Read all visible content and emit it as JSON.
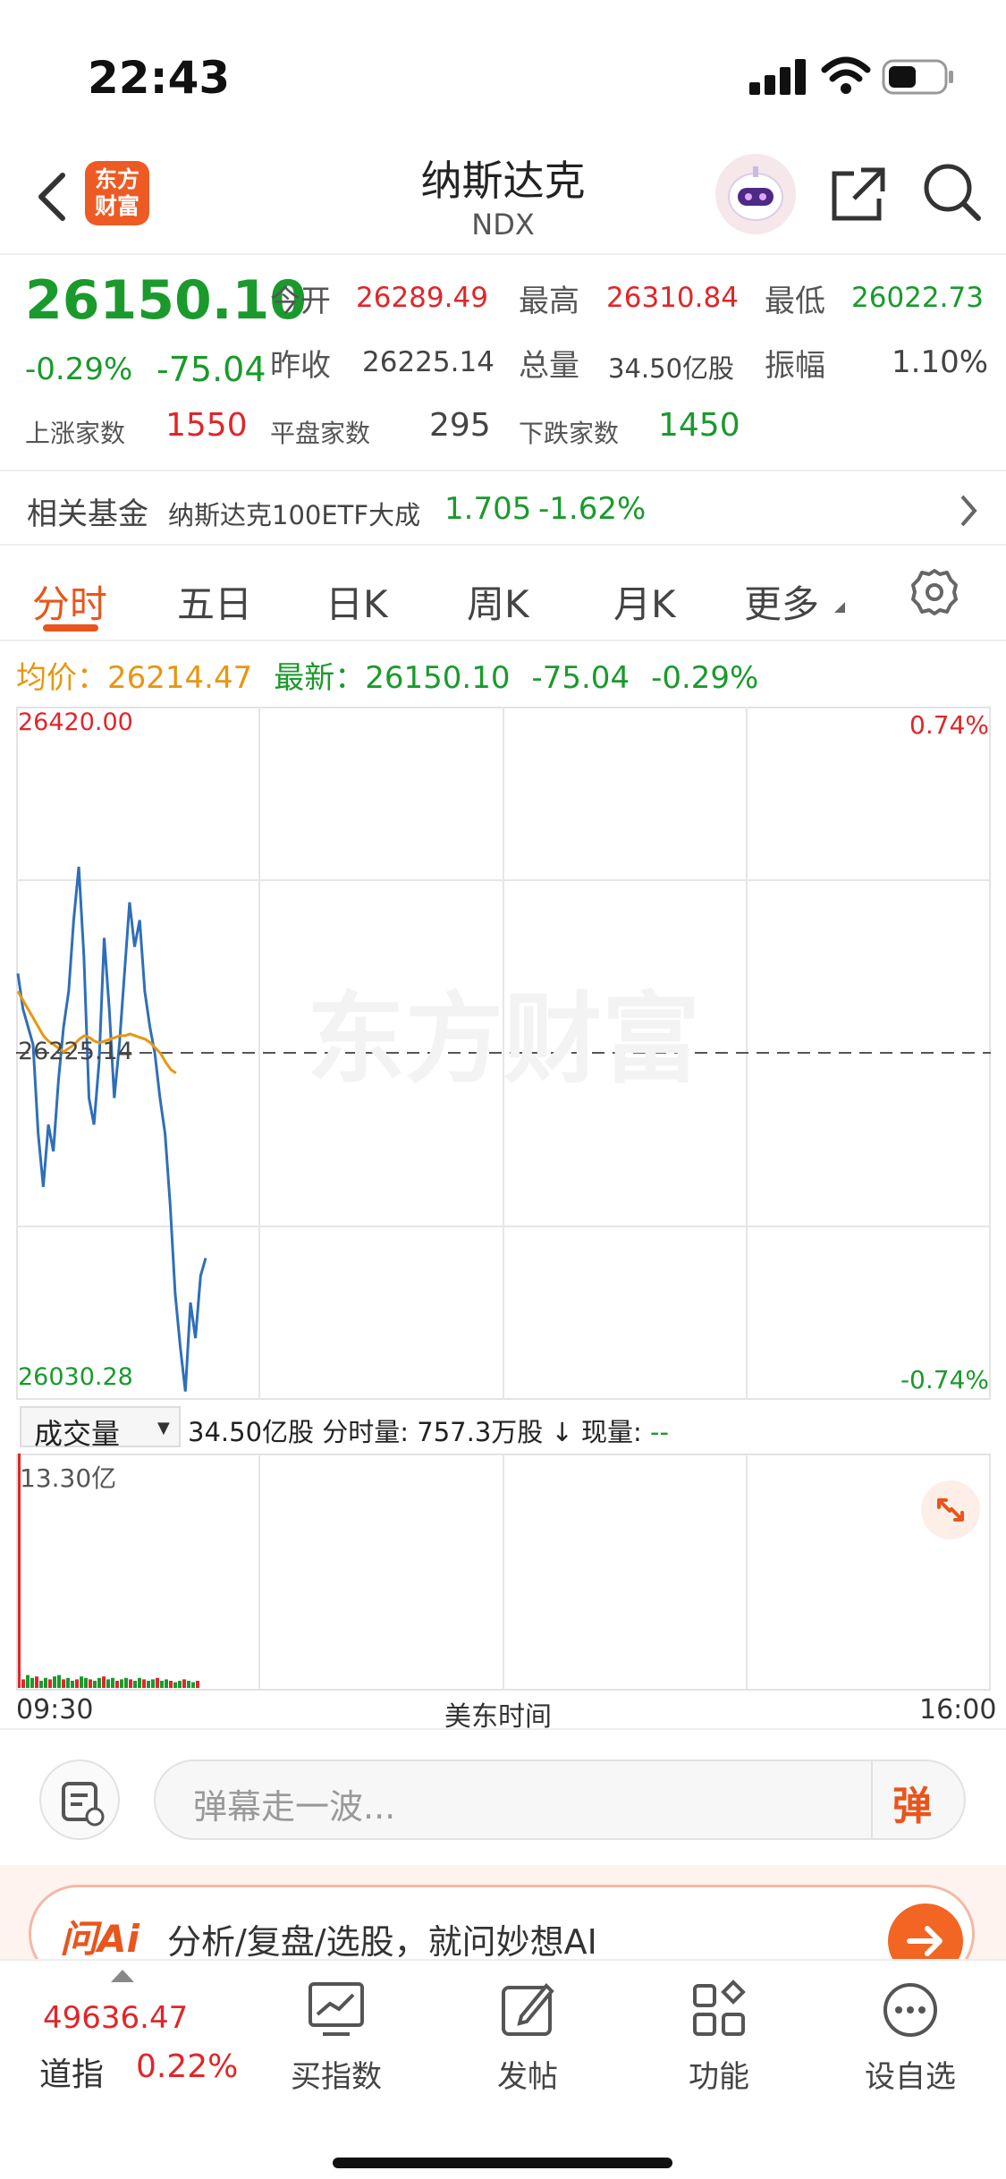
{
  "status": {
    "time": "22:43"
  },
  "nav": {
    "title": "纳斯达克",
    "subtitle": "NDX",
    "logo_line1": "东方",
    "logo_line2": "财富"
  },
  "quote": {
    "price": "26150.10",
    "change_pct": "-0.29%",
    "change": "-75.04",
    "open_label": "今开",
    "open": "26289.49",
    "high_label": "最高",
    "high": "26310.84",
    "low_label": "最低",
    "low": "26022.73",
    "prev_close_label": "昨收",
    "prev_close": "26225.14",
    "volume_label": "总量",
    "volume": "34.50亿股",
    "amplitude_label": "振幅",
    "amplitude": "1.10%",
    "up_label": "上涨家数",
    "up": "1550",
    "flat_label": "平盘家数",
    "flat": "295",
    "down_label": "下跌家数",
    "down": "1450"
  },
  "fund": {
    "label": "相关基金",
    "name": "纳斯达克100ETF大成",
    "price": "1.705",
    "change": "-1.62%"
  },
  "tabs": [
    "分时",
    "五日",
    "日K",
    "周K",
    "月K",
    "更多"
  ],
  "chart_header": {
    "avg_label": "均价：",
    "avg": "26214.47",
    "latest_label": "最新：",
    "latest": "26150.10",
    "change": "-75.04",
    "pct": "-0.29%"
  },
  "chart_data": {
    "type": "line",
    "y_top": "26420.00",
    "y_bottom": "26030.28",
    "y_mid": "26225.14",
    "pct_top": "0.74%",
    "pct_bottom": "-0.74%",
    "ylim": [
      26030.28,
      26420.0
    ],
    "series": [
      {
        "name": "",
        "values": [
          26270,
          26250,
          26240,
          26230,
          26180,
          26150,
          26185,
          26170,
          26210,
          26240,
          26260,
          26300,
          26330,
          26280,
          26200,
          26185,
          26220,
          26290,
          26250,
          26200,
          26230,
          26270,
          26310,
          26285,
          26300,
          26260,
          26240,
          26225,
          26200,
          26180,
          26140,
          26090,
          26060,
          26035,
          26085,
          26065,
          26100,
          26110
        ]
      },
      {
        "name": "",
        "values": [
          26260,
          26255,
          26250,
          26245,
          26240,
          26235,
          26232,
          26230,
          26228,
          26226,
          26228,
          26230,
          26233,
          26235,
          26234,
          26232,
          26231,
          26232,
          26233,
          26234,
          26235,
          26235,
          26236,
          26235,
          26234,
          26233,
          26231,
          26228,
          26225,
          26220,
          26216,
          26214
        ]
      }
    ],
    "x_start": "09:30",
    "x_mid": "美东时间",
    "x_end": "16:00"
  },
  "volume": {
    "selector": "成交量",
    "total": "34.50亿股",
    "minute_label": "分时量:",
    "minute": "757.3万股",
    "arrow": "↓",
    "now_label": "现量:",
    "now": "--",
    "max": "13.30亿"
  },
  "danmu": {
    "placeholder": "弹幕走一波...",
    "button": "弹"
  },
  "ai": {
    "logo": "问Ai",
    "text": "分析/复盘/选股，就问妙想AI"
  },
  "tabbar": {
    "index_value": "49636.47",
    "index_name": "道指",
    "index_pct": "0.22%",
    "items": [
      "买指数",
      "发帖",
      "功能",
      "设自选"
    ]
  },
  "watermark": "东方财富"
}
